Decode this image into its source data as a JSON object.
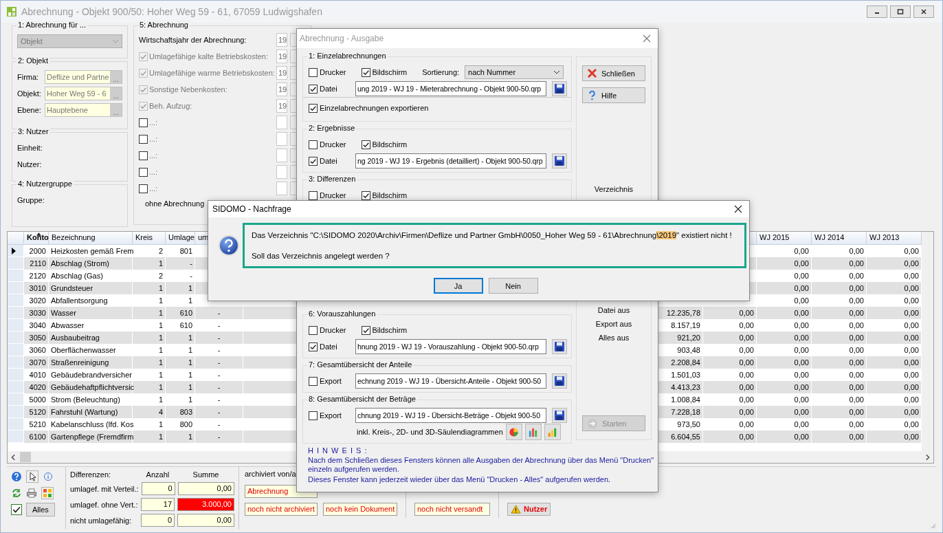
{
  "window": {
    "title": "Abrechnung - Objekt 900/50:  Hoher Weg 59 - 61, 67059 Ludwigshafen"
  },
  "billing_for": {
    "title": "1: Abrechnung für ...",
    "select": "Objekt"
  },
  "object": {
    "title": "2: Objekt",
    "fields": [
      {
        "label": "Firma:",
        "value": "Deflize und Partne",
        "button": "..."
      },
      {
        "label": "Objekt:",
        "value": "Hoher Weg 59 - 6",
        "button": "..."
      },
      {
        "label": "Ebene:",
        "value": "Hauptebene",
        "button": "..."
      }
    ]
  },
  "tenant": {
    "title": "3: Nutzer",
    "labels": [
      "Einheit:",
      "Nutzer:"
    ]
  },
  "tenant_group": {
    "title": "4: Nutzergruppe",
    "labels": [
      "Gruppe:"
    ]
  },
  "billing": {
    "title": "5: Abrechnung",
    "rows": [
      {
        "kind": "plain",
        "label": "Wirtschaftsjahr der Abrechnung:",
        "value": "19"
      },
      {
        "kind": "check",
        "label": "Umlagefähige kalte Betriebskosten:",
        "checked": true,
        "disabled": true,
        "value": "19"
      },
      {
        "kind": "check",
        "label": "Umlagefähige warme Betriebskosten:",
        "checked": true,
        "disabled": true,
        "value": "19"
      },
      {
        "kind": "check",
        "label": "Sonstige Nebenkosten:",
        "checked": true,
        "disabled": true,
        "value": "19"
      },
      {
        "kind": "check",
        "label": "Beh. Aufzug:",
        "checked": true,
        "disabled": true,
        "value": "19"
      },
      {
        "kind": "check",
        "label": "...:",
        "checked": false,
        "disabled": false
      },
      {
        "kind": "check",
        "label": "...:",
        "checked": false,
        "disabled": false
      },
      {
        "kind": "check",
        "label": "...:",
        "checked": false,
        "disabled": false
      },
      {
        "kind": "check",
        "label": "...:",
        "checked": false,
        "disabled": false
      },
      {
        "kind": "check",
        "label": "...:",
        "checked": false,
        "disabled": false
      }
    ],
    "footer": "ohne Abrechnung"
  },
  "table": {
    "columns": [
      "Konto",
      "Bezeichnung",
      "Kreis",
      "Umlage",
      "um",
      "WJ 2015",
      "WJ 2014",
      "WJ 2013"
    ],
    "rows": [
      {
        "selected": true,
        "konto": "2000",
        "name": "Heizkosten gemäß Frem",
        "kreis": "2",
        "umlage": "801",
        "wj_2015": "0,00",
        "wj_2014": "0,00",
        "wj_2013": "0,00"
      },
      {
        "selected": false,
        "konto": "2110",
        "name": "Abschlag (Strom)",
        "kreis": "1",
        "umlage": "-",
        "wj_2015": "0,00",
        "wj_2014": "0,00",
        "wj_2013": "0,00"
      },
      {
        "selected": false,
        "konto": "2120",
        "name": "Abschlag (Gas)",
        "kreis": "2",
        "umlage": "-",
        "wj_2015": "0,00",
        "wj_2014": "0,00",
        "wj_2013": "0,00"
      },
      {
        "selected": false,
        "konto": "3010",
        "name": "Grundsteuer",
        "kreis": "1",
        "umlage": "1",
        "wj_2015": "0,00",
        "wj_2014": "0,00",
        "wj_2013": "0,00"
      },
      {
        "selected": false,
        "konto": "3020",
        "name": "Abfallentsorgung",
        "kreis": "1",
        "umlage": "1",
        "wj_2015": "0,00",
        "wj_2014": "0,00",
        "wj_2013": "0,00"
      },
      {
        "selected": false,
        "konto": "3030",
        "name": "Wasser",
        "kreis": "1",
        "umlage": "610",
        "um": "-",
        "column_6": "12.235,78",
        "column_7": "0,00",
        "wj_2015": "0,00",
        "wj_2014": "0,00",
        "wj_2013": "0,00"
      },
      {
        "selected": false,
        "konto": "3040",
        "name": "Abwasser",
        "kreis": "1",
        "umlage": "610",
        "um": "-",
        "column_6": "8.157,19",
        "column_7": "0,00",
        "wj_2015": "0,00",
        "wj_2014": "0,00",
        "wj_2013": "0,00"
      },
      {
        "selected": false,
        "konto": "3050",
        "name": "Ausbaubeitrag",
        "kreis": "1",
        "umlage": "1",
        "um": "-",
        "column_6": "921,20",
        "column_7": "0,00",
        "wj_2015": "0,00",
        "wj_2014": "0,00",
        "wj_2013": "0,00"
      },
      {
        "selected": false,
        "konto": "3060",
        "name": "Oberflächenwasser",
        "kreis": "1",
        "umlage": "1",
        "um": "-",
        "column_6": "903,48",
        "column_7": "0,00",
        "wj_2015": "0,00",
        "wj_2014": "0,00",
        "wj_2013": "0,00"
      },
      {
        "selected": false,
        "konto": "3070",
        "name": "Straßenreinigung",
        "kreis": "1",
        "umlage": "1",
        "um": "-",
        "column_6": "2.208,84",
        "column_7": "0,00",
        "wj_2015": "0,00",
        "wj_2014": "0,00",
        "wj_2013": "0,00"
      },
      {
        "selected": false,
        "konto": "4010",
        "name": "Gebäudebrandversicher",
        "kreis": "1",
        "umlage": "1",
        "um": "-",
        "column_6": "1.501,03",
        "column_7": "0,00",
        "wj_2015": "0,00",
        "wj_2014": "0,00",
        "wj_2013": "0,00"
      },
      {
        "selected": false,
        "konto": "4020",
        "name": "Gebäudehaftpflichtversic",
        "kreis": "1",
        "umlage": "1",
        "um": "-",
        "column_6": "4.413,23",
        "column_7": "0,00",
        "wj_2015": "0,00",
        "wj_2014": "0,00",
        "wj_2013": "0,00"
      },
      {
        "selected": false,
        "konto": "5000",
        "name": "Strom (Beleuchtung)",
        "kreis": "1",
        "umlage": "1",
        "um": "-",
        "column_6": "1.008,84",
        "column_7": "0,00",
        "wj_2015": "0,00",
        "wj_2014": "0,00",
        "wj_2013": "0,00"
      },
      {
        "selected": false,
        "konto": "5120",
        "name": "Fahrstuhl (Wartung)",
        "kreis": "4",
        "umlage": "803",
        "um": "-",
        "column_6": "7.228,18",
        "column_7": "0,00",
        "wj_2015": "0,00",
        "wj_2014": "0,00",
        "wj_2013": "0,00"
      },
      {
        "selected": false,
        "konto": "5210",
        "name": "Kabelanschluss (lfd. Kos",
        "kreis": "1",
        "umlage": "800",
        "um": "-",
        "column_6": "973,50",
        "column_7": "0,00",
        "wj_2015": "0,00",
        "wj_2014": "0,00",
        "wj_2013": "0,00"
      },
      {
        "selected": false,
        "konto": "6100",
        "name": "Gartenpflege (Fremdfirm",
        "kreis": "1",
        "umlage": "1",
        "um": "-",
        "column_6": "6.604,55",
        "column_7": "0,00",
        "wj_2015": "0,00",
        "wj_2014": "0,00",
        "wj_2013": "0,00"
      }
    ]
  },
  "tools": {
    "button": "Alles",
    "checked": true
  },
  "differences": {
    "title": "Differenzen:",
    "headers": [
      "Anzahl",
      "Summe"
    ],
    "rows": [
      {
        "label": "umlagef. mit Verteil.:",
        "count": "0",
        "sum": "0,00",
        "alert": false
      },
      {
        "label": "umlagef. ohne Vert.:",
        "count": "17",
        "sum": "3.000,00",
        "alert": true
      },
      {
        "label": "nicht umlagefähig:",
        "count": "0",
        "sum": "0,00",
        "alert": false
      }
    ]
  },
  "archive": {
    "title": "archiviert von/a",
    "document": "Abrechnung",
    "status": [
      "noch nicht archiviert",
      "noch kein Dokument",
      "noch nicht versandt"
    ],
    "tenant_button": "Nutzer"
  },
  "output_dialog": {
    "title": "Abrechnung - Ausgabe",
    "sections_top": [
      {
        "title": "1: Einzelabrechnungen",
        "rows": [
          {
            "kind": "checks",
            "items": [
              {
                "label": "Drucker",
                "checked": false
              },
              {
                "label": "Bildschirm",
                "checked": true
              }
            ],
            "sort_label": "Sortierung:",
            "sort": "nach Nummer"
          },
          {
            "kind": "file",
            "label": "Datei",
            "checked": true,
            "path": "ung 2019 - WJ 19 - Mieterabrechnung - Objekt 900-50.qrp"
          },
          {
            "kind": "check",
            "label": "Einzelabrechnungen exportieren",
            "checked": true
          }
        ]
      },
      {
        "title": "2: Ergebnisse",
        "rows": [
          {
            "kind": "checks",
            "items": [
              {
                "label": "Drucker",
                "checked": false
              },
              {
                "label": "Bildschirm",
                "checked": true
              }
            ]
          },
          {
            "kind": "file",
            "label": "Datei",
            "checked": true,
            "path": "ng 2019 - WJ 19 - Ergebnis (detailliert) - Objekt 900-50.qrp"
          }
        ]
      },
      {
        "title": "3: Differenzen",
        "rows": [
          {
            "kind": "checks",
            "items": [
              {
                "label": "Drucker",
                "checked": false
              },
              {
                "label": "Bildschirm",
                "checked": true
              }
            ]
          }
        ]
      }
    ],
    "sections_bottom": [
      {
        "title": "6: Vorauszahlungen",
        "rows": [
          {
            "kind": "checks",
            "items": [
              {
                "label": "Drucker",
                "checked": false
              },
              {
                "label": "Bildschirm",
                "checked": true
              }
            ]
          },
          {
            "kind": "file",
            "label": "Datei",
            "checked": true,
            "path": "hnung 2019 - WJ 19 - Vorauszahlung - Objekt 900-50.qrp"
          }
        ]
      },
      {
        "title": "7: Gesamtübersicht der Anteile",
        "rows": [
          {
            "kind": "file",
            "label": "Export",
            "checked": false,
            "path": "echnung 2019 - WJ 19 - Übersicht-Anteile - Objekt 900-50"
          }
        ]
      },
      {
        "title": "8: Gesamtübersicht der Beträge",
        "rows": [
          {
            "kind": "file",
            "label": "Export",
            "checked": false,
            "path": "chnung 2019 - WJ 19 - Übersicht-Beträge - Objekt 900-50"
          },
          {
            "kind": "charts",
            "label": "inkl. Kreis-, 2D- und 3D-Säulendiagrammen"
          }
        ]
      }
    ],
    "side": {
      "buttons": [
        {
          "kind": "close",
          "label": "Schließen"
        },
        {
          "kind": "help",
          "label": "Hilfe"
        }
      ],
      "dir_label": "Verzeichnis",
      "off_labels": [
        "Datei aus",
        "Export aus",
        "Alles aus"
      ],
      "start": {
        "label": "Starten",
        "disabled": true
      }
    },
    "note": {
      "title": "H I N W E I S :",
      "lines": [
        "Nach dem Schließen dieses Fensters können alle Ausgaben der Abrechnung über das Menü \"Drucken\" einzeln aufgerufen werden.",
        "Dieses Fenster kann jederzeit wieder über das Menü \"Drucken - Alles\" aufgerufen werden."
      ]
    }
  },
  "confirm_dialog": {
    "title": "SIDOMO - Nachfrage",
    "message": [
      {
        "text": "Das Verzeichnis \"C:\\SIDOMO 2020\\Archiv\\Firmen\\Deflize und Partner GmbH\\0050_Hoher Weg 59 - 61\\Abrechnung",
        "highlight": false
      },
      {
        "text": "\\2019",
        "highlight": true
      },
      {
        "text": "\" existiert nicht !",
        "highlight": false
      }
    ],
    "question": "Soll das Verzeichnis angelegt werden ?",
    "buttons": [
      {
        "label": "Ja",
        "selected": true
      },
      {
        "label": "Nein",
        "selected": false
      }
    ]
  }
}
